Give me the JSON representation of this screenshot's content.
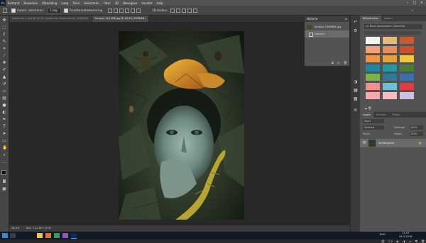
{
  "menubar": {
    "logo": "Ps",
    "items": [
      "Bestand",
      "Bewerken",
      "Afbeelding",
      "Laag",
      "Tekst",
      "Selecteren",
      "Filter",
      "3D",
      "Weergave",
      "Venster",
      "Help"
    ]
  },
  "optbar": {
    "auto_select_label": "Autom. selecteren:",
    "auto_select_value": "Laag",
    "transform_label": "Transformatiebesturing",
    "mode_3d_label": "3D-modus:"
  },
  "tabs": [
    {
      "label": "Drakenen-L.psd @ 16,7% (Drakenen-lichtcentrum, RGB/8#)"
    },
    {
      "label": "Fantasy (2)1586.jpg @ 46,4% (RGB/8#)"
    }
  ],
  "history": {
    "title": "Historie",
    "items": [
      "fantasy-1586984.jpg",
      "Openen"
    ]
  },
  "right_panel": {
    "tabs": [
      "Bibliotheken",
      "Stalen"
    ],
    "library_name": "CC Basis Adressstalen Swatchlib",
    "swatches": [
      [
        "#f3f3f3",
        "#e8b77a",
        "#c65b2f"
      ],
      [
        "#f2a37b",
        "#e98c5c",
        "#d24b2d"
      ],
      [
        "#f1923f",
        "#e5a135",
        "#f2c63a"
      ],
      [
        "#1d86a2",
        "#1f9aa1",
        "#4b7b38"
      ],
      [
        "#7ab446",
        "#2c7a97",
        "#3b6fb0"
      ],
      [
        "#f18f8f",
        "#6bc0d9",
        "#e43b41"
      ],
      [
        "#f8a8a8",
        "#f9b9bd",
        "#cbbfe4"
      ]
    ],
    "layers_tabs": [
      "Lagen",
      "Kanalen",
      "Paden"
    ],
    "kind_label": "Soort",
    "blend_mode": "Normaal",
    "opacity_label": "Dekking:",
    "opacity_value": "100%",
    "lock_label": "Vergr.:",
    "fill_label": "Vullen:",
    "fill_value": "100%",
    "layer_name": "Achtergrond"
  },
  "statusbar": {
    "zoom": "46,4%",
    "doc_info": "Doc: 7,22 M/7,22 M"
  },
  "taskbar": {
    "time": "11:57",
    "date": "28-3-2018",
    "lang": "ENG"
  }
}
